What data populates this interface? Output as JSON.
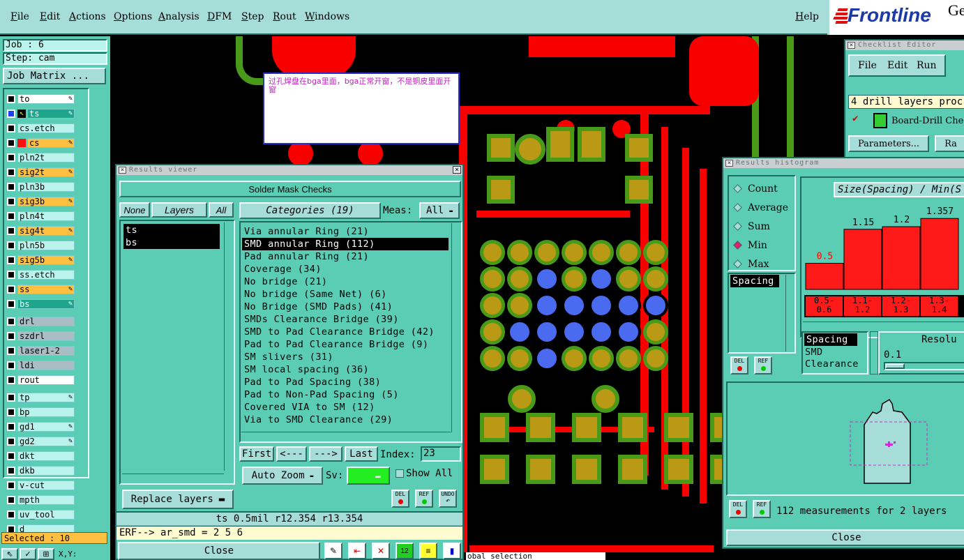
{
  "menu": {
    "items": [
      "File",
      "Edit",
      "Actions",
      "Options",
      "Analysis",
      "DFM",
      "Step",
      "Rout",
      "Windows"
    ],
    "help": "Help"
  },
  "logo": {
    "brand": "Frontline",
    "suffix": "Ge"
  },
  "job": {
    "job_label": "Job : 6",
    "step_label": "Step: cam",
    "matrix_button": "Job Matrix ..."
  },
  "layers": [
    {
      "name": "to",
      "style": "w",
      "pen": true,
      "active": false
    },
    {
      "name": "ts",
      "style": "g",
      "pen": true,
      "active": true
    },
    {
      "name": "cs.etch",
      "style": "c",
      "pen": false,
      "active": false
    },
    {
      "name": "cs",
      "style": "y",
      "pen": true,
      "active": false,
      "red": true
    },
    {
      "name": "pln2t",
      "style": "c",
      "pen": false,
      "active": false
    },
    {
      "name": "sig2t",
      "style": "y",
      "pen": true,
      "active": false
    },
    {
      "name": "pln3b",
      "style": "c",
      "pen": false,
      "active": false
    },
    {
      "name": "sig3b",
      "style": "y",
      "pen": true,
      "active": false
    },
    {
      "name": "pln4t",
      "style": "c",
      "pen": false,
      "active": false
    },
    {
      "name": "sig4t",
      "style": "y",
      "pen": true,
      "active": false
    },
    {
      "name": "pln5b",
      "style": "c",
      "pen": false,
      "active": false
    },
    {
      "name": "sig5b",
      "style": "y",
      "pen": true,
      "active": false
    },
    {
      "name": "ss.etch",
      "style": "c",
      "pen": false,
      "active": false
    },
    {
      "name": "ss",
      "style": "y",
      "pen": true,
      "active": false
    },
    {
      "name": "bs",
      "style": "g",
      "pen": true,
      "active": false
    },
    {
      "name": "drl",
      "style": "s",
      "pen": false,
      "active": false
    },
    {
      "name": "szdrl",
      "style": "s",
      "pen": false,
      "active": false
    },
    {
      "name": "laser1-2",
      "style": "s",
      "pen": false,
      "active": false
    },
    {
      "name": "ldi",
      "style": "s",
      "pen": false,
      "active": false
    },
    {
      "name": "rout",
      "style": "w",
      "pen": false,
      "active": false
    },
    {
      "name": "tp",
      "style": "c",
      "pen": true,
      "active": false
    },
    {
      "name": "bp",
      "style": "c",
      "pen": false,
      "active": false
    },
    {
      "name": "gd1",
      "style": "c",
      "pen": true,
      "active": false
    },
    {
      "name": "gd2",
      "style": "c",
      "pen": true,
      "active": false
    },
    {
      "name": "dkt",
      "style": "c",
      "pen": false,
      "active": false
    },
    {
      "name": "dkb",
      "style": "c",
      "pen": false,
      "active": false
    },
    {
      "name": "v-cut",
      "style": "c",
      "pen": false,
      "active": false
    },
    {
      "name": "mpth",
      "style": "c",
      "pen": false,
      "active": false
    },
    {
      "name": "uv_tool",
      "style": "c",
      "pen": false,
      "active": false
    },
    {
      "name": "d",
      "style": "c",
      "pen": false,
      "active": false
    }
  ],
  "selected_label": "Selected : 10",
  "bottom_coords": "X,Y:",
  "status_tail": "obal selection",
  "note": {
    "text": "过孔焊盘在bga里面，bga正常开窗，不是铜皮里面开窗"
  },
  "results_viewer": {
    "title": "Results viewer",
    "header": "Solder Mask Checks",
    "none_btn": "None",
    "layers_btn": "Layers",
    "all_btn": "All",
    "layers": [
      "ts",
      "bs"
    ],
    "categories_btn": "Categories (19)",
    "meas_label": "Meas:",
    "meas_value": "All",
    "categories": [
      "Via annular Ring (21)",
      "SMD annular Ring (112)",
      "Pad annular Ring (21)",
      "Coverage (34)",
      "No bridge (21)",
      "No bridge (Same Net) (6)",
      "No Bridge (SMD Pads) (41)",
      "SMDs Clearance Bridge (39)",
      "SMD to Pad Clearance Bridge (42)",
      "Pad to Pad Clearance Bridge (9)",
      "SM slivers (31)",
      "SM local spacing (36)",
      "Pad to Pad Spacing (38)",
      "Pad to Non-Pad Spacing (5)",
      "Covered VIA to SM (12)",
      "Via to SMD Clearance (29)"
    ],
    "selected_category_index": 1,
    "first": "First",
    "prev": "<---",
    "next": "--->",
    "last": "Last",
    "index_label": "Index:",
    "index_value": "23",
    "auto_zoom": "Auto Zoom",
    "sv_label": "Sv:",
    "show_all": "Show All",
    "replace_layers": "Replace layers",
    "del": "DEL",
    "ref": "REF",
    "undo": "UNDO",
    "status": "ts 0.5mil  r12.354  r13.354",
    "erf": "ERF--> ar_smd = 2 5 6",
    "close": "Close"
  },
  "checklist": {
    "title": "Checklist Editor",
    "menu": [
      "File",
      "Edit",
      "Run"
    ],
    "summary": "4 drill layers proc",
    "action": "Board-Drill Che",
    "parameters_btn": "Parameters...",
    "ra_btn": "Ra"
  },
  "histogram": {
    "title": "Results histogram",
    "modes": [
      "Count",
      "Average",
      "Sum",
      "Min",
      "Max"
    ],
    "selected_mode": "Min",
    "chart_title": "Size(Spacing) / Min(S",
    "left_list": [
      "Spacing"
    ],
    "bins": [
      "0.5-\n0.6",
      "1.1-\n1.2",
      "1.2-\n1.3",
      "1.3-\n1.4"
    ],
    "lower_list": [
      "Spacing",
      "SMD",
      "Clearance"
    ],
    "resolution_label": "Resolu",
    "resolution_value": "0.1",
    "measurements": "112 measurements for 2 layers",
    "close": "Close",
    "del": "DEL",
    "ref": "REF"
  },
  "chart_data": {
    "type": "bar",
    "categories": [
      "0.5-0.6",
      "1.1-1.2",
      "1.2-1.3",
      "1.3-1.4"
    ],
    "values": [
      0.5,
      1.15,
      1.2,
      1.357
    ],
    "ylim": [
      0,
      1.6
    ],
    "color": "#ff1a1a",
    "highlight_label_color": "#ff0000"
  },
  "colors": {
    "panel": "#5ccdb5",
    "panel_light": "#a7ddd9",
    "trace_red": "#f80000",
    "pad_olive": "#ba9a14",
    "mask_green": "#4a9a1a",
    "via_blue": "#4a6af0"
  }
}
